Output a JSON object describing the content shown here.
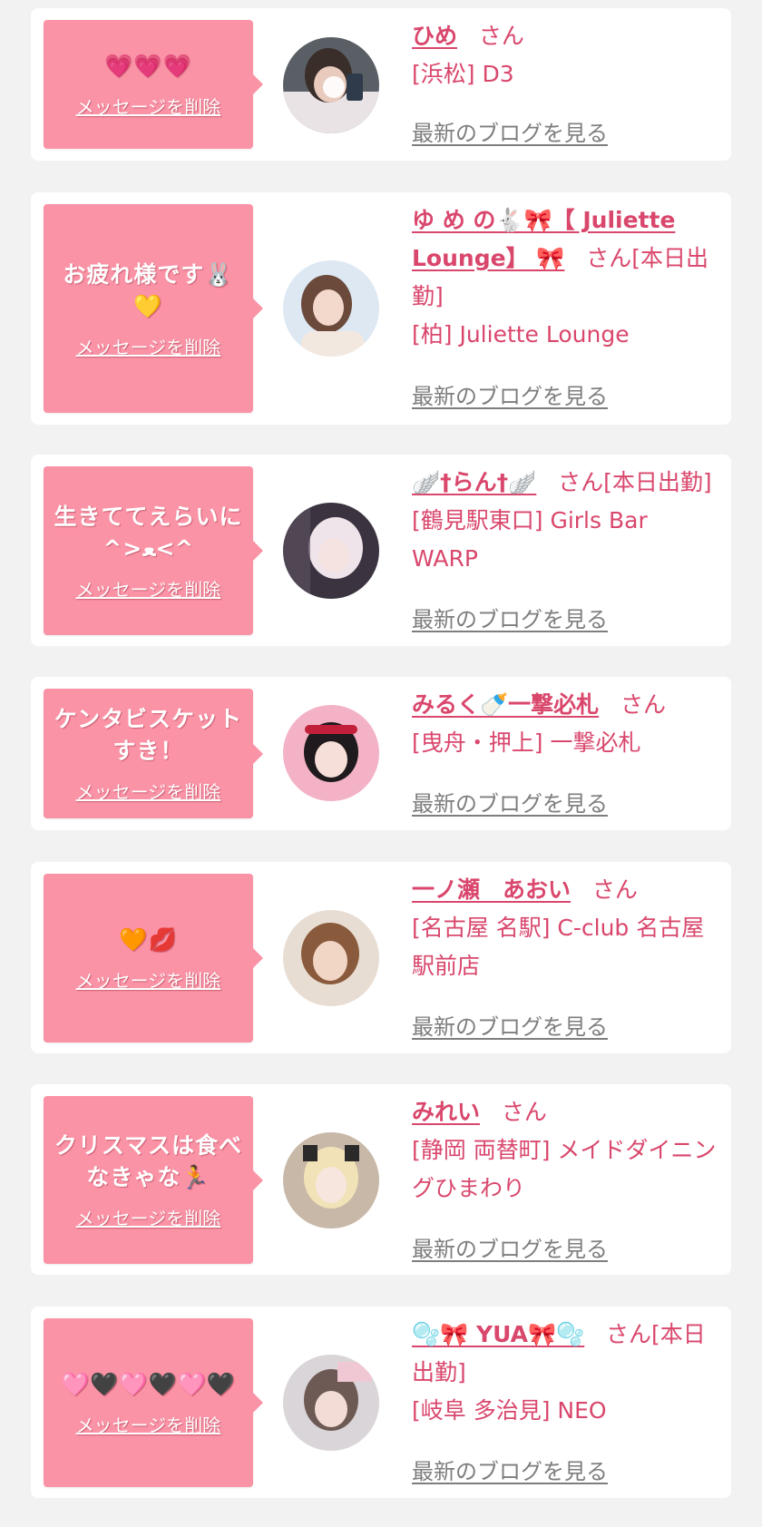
{
  "delete_label": "メッセージを削除",
  "blog_label": "最新のブログを見る",
  "cards": [
    {
      "message": "💗💗💗",
      "name": "ひめ",
      "suffix": "さん",
      "area": "[浜松] D3",
      "avatar_icon": "profile-photo-avatar-icon"
    },
    {
      "message": "お疲れ様です🐰💛",
      "name": "ゆ め の🐇🎀【 Juliette Lounge】 🎀",
      "suffix": "さん[本日出勤]",
      "area": "[柏] Juliette Lounge",
      "avatar_icon": "profile-photo-avatar-icon"
    },
    {
      "message": "生きててえらいに^>ﻌ<^",
      "name": "🪽†らん†🪽",
      "suffix": "さん[本日出勤]",
      "area": "[鶴見駅東口] Girls Bar WARP",
      "avatar_icon": "profile-photo-avatar-icon"
    },
    {
      "message": "ケンタビスケットすき！",
      "name": "みるく🍼一撃必札",
      "suffix": "さん",
      "area": "[曳舟・押上] 一撃必札",
      "avatar_icon": "profile-photo-avatar-icon"
    },
    {
      "message": "🧡💋",
      "name": "一ノ瀬　あおい",
      "suffix": "さん",
      "area": "[名古屋 名駅] C-club 名古屋駅前店",
      "avatar_icon": "profile-photo-avatar-icon"
    },
    {
      "message": "クリスマスは食べなきゃな🏃",
      "name": "みれい",
      "suffix": "さん",
      "area": "[静岡 両替町] メイドダイニングひまわり",
      "avatar_icon": "profile-photo-avatar-icon"
    },
    {
      "message": "🩷🖤🩷🖤🩷🖤",
      "name": "🫧🎀 YUA🎀🫧",
      "suffix": "さん[本日出勤]",
      "area": "[岐阜 多治見] NEO",
      "avatar_icon": "profile-photo-avatar-icon"
    }
  ],
  "colors": {
    "background": "#f2f2f2",
    "card": "#ffffff",
    "bubble": "#fb93a6",
    "accent_text": "#d9476c",
    "blog_link": "#7e7e7e"
  }
}
